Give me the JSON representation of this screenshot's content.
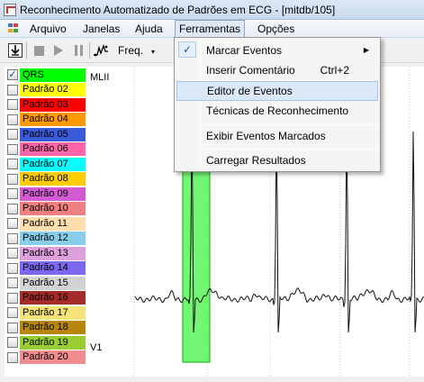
{
  "window": {
    "title": "Reconhecimento Automatizado de Padrões em ECG - [mitdb/105]",
    "app_icon": "ecg-app-icon"
  },
  "menubar": {
    "items": [
      {
        "label": "Arquivo"
      },
      {
        "label": "Janelas"
      },
      {
        "label": "Ajuda"
      },
      {
        "label": "Ferramentas",
        "active": true
      },
      {
        "label": "Opções"
      }
    ]
  },
  "toolbar": {
    "icons": [
      "download-icon",
      "stop-icon",
      "play-icon",
      "pause-icon",
      "waveform-icon"
    ],
    "freq_label": "Freq.",
    "caret": "▾"
  },
  "patterns": [
    {
      "label": "QRS",
      "color": "#00ff00",
      "checked": true
    },
    {
      "label": "Padrão 02",
      "color": "#ffff00",
      "checked": false
    },
    {
      "label": "Padrão 03",
      "color": "#ff0000",
      "checked": false
    },
    {
      "label": "Padrão 04",
      "color": "#ff9900",
      "checked": false
    },
    {
      "label": "Padrão 05",
      "color": "#3a5bd9",
      "checked": false
    },
    {
      "label": "Padrão 06",
      "color": "#ff66aa",
      "checked": false
    },
    {
      "label": "Padrão 07",
      "color": "#00ffff",
      "checked": false
    },
    {
      "label": "Padrão 08",
      "color": "#ffcc00",
      "checked": false
    },
    {
      "label": "Padrão 09",
      "color": "#d45ad4",
      "checked": false
    },
    {
      "label": "Padrão 10",
      "color": "#f08080",
      "checked": false
    },
    {
      "label": "Padrão 11",
      "color": "#ffdead",
      "checked": false
    },
    {
      "label": "Padrão 12",
      "color": "#87ceeb",
      "checked": false
    },
    {
      "label": "Padrão 13",
      "color": "#dda0dd",
      "checked": false
    },
    {
      "label": "Padrão 14",
      "color": "#7b68ee",
      "checked": false
    },
    {
      "label": "Padrão 15",
      "color": "#d3d3d3",
      "checked": false
    },
    {
      "label": "Padrão 16",
      "color": "#a52a2a",
      "checked": false
    },
    {
      "label": "Padrão 17",
      "color": "#f5e37a",
      "checked": false
    },
    {
      "label": "Padrão 18",
      "color": "#b8860b",
      "checked": false
    },
    {
      "label": "Padrão 19",
      "color": "#9acd32",
      "checked": false
    },
    {
      "label": "Padrão 20",
      "color": "#f08c8c",
      "checked": false
    }
  ],
  "ecg": {
    "lead_top": "MLII",
    "lead_bottom": "V1",
    "highlight_color": "#00ee00"
  },
  "dropdown": {
    "items": [
      {
        "label": "Marcar Eventos",
        "checked": true,
        "submenu": true
      },
      {
        "label": "Inserir Comentário",
        "shortcut": "Ctrl+2"
      },
      {
        "label": "Editor de Eventos",
        "highlight": true
      },
      {
        "label": "Técnicas de Reconhecimento"
      },
      {
        "label": "Exibir Eventos Marcados"
      },
      {
        "label": "Carregar Resultados"
      }
    ],
    "check_glyph": "✓",
    "submenu_glyph": "▶"
  }
}
